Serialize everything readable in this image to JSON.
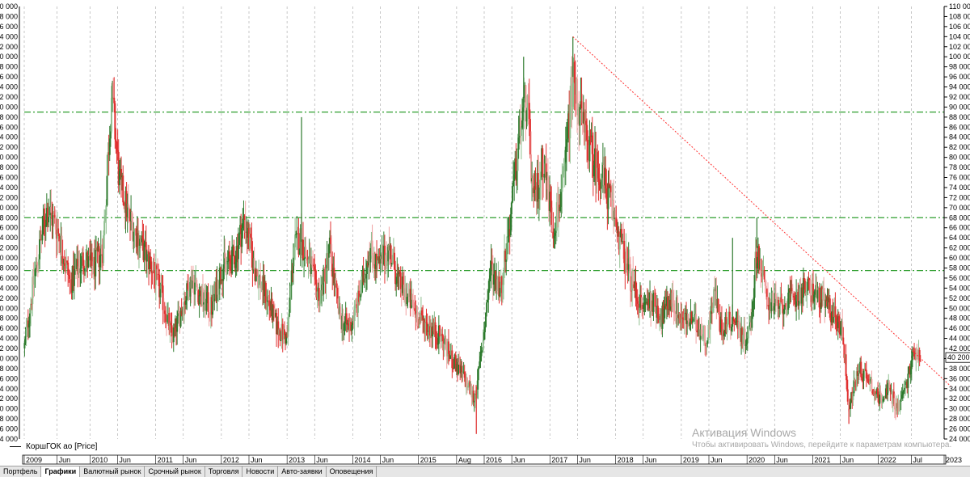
{
  "chart_data": {
    "type": "candlestick",
    "ylim": [
      24000,
      110000
    ],
    "y_ticks": [
      24000,
      26000,
      28000,
      30000,
      32000,
      34000,
      36000,
      38000,
      40000,
      42000,
      44000,
      46000,
      48000,
      50000,
      52000,
      54000,
      56000,
      58000,
      60000,
      62000,
      64000,
      66000,
      68000,
      70000,
      72000,
      74000,
      76000,
      78000,
      80000,
      82000,
      84000,
      86000,
      88000,
      90000,
      92000,
      94000,
      96000,
      98000,
      100000,
      102000,
      104000,
      106000,
      108000,
      110000
    ],
    "y_tick_labels": [
      "24 000",
      "26 000",
      "28 000",
      "30 000",
      "32 000",
      "34 000",
      "36 000",
      "38 000",
      "40 000",
      "42 000",
      "44 000",
      "46 000",
      "48 000",
      "50 000",
      "52 000",
      "54 000",
      "56 000",
      "58 000",
      "60 000",
      "62 000",
      "64 000",
      "66 000",
      "68 000",
      "70 000",
      "72 000",
      "74 000",
      "76 000",
      "78 000",
      "80 000",
      "82 000",
      "84 000",
      "86 000",
      "88 000",
      "90 000",
      "92 000",
      "94 000",
      "96 000",
      "98 000",
      "100 000",
      "102 000",
      "104 000",
      "106 000",
      "108 000",
      "110 000"
    ],
    "last_price_label": "40 200",
    "last_price": 40200,
    "time_labels": [
      {
        "t": 2009.0,
        "label": "2009"
      },
      {
        "t": 2009.5,
        "label": "Jun"
      },
      {
        "t": 2010.0,
        "label": "2010"
      },
      {
        "t": 2010.42,
        "label": "Jun"
      },
      {
        "t": 2011.0,
        "label": "2011"
      },
      {
        "t": 2011.42,
        "label": "Jun"
      },
      {
        "t": 2012.0,
        "label": "2012"
      },
      {
        "t": 2012.42,
        "label": "Jun"
      },
      {
        "t": 2013.0,
        "label": "2013"
      },
      {
        "t": 2013.42,
        "label": "Jun"
      },
      {
        "t": 2014.0,
        "label": "2014"
      },
      {
        "t": 2014.42,
        "label": "Jun"
      },
      {
        "t": 2015.0,
        "label": "2015"
      },
      {
        "t": 2015.58,
        "label": "Aug"
      },
      {
        "t": 2016.0,
        "label": "2016"
      },
      {
        "t": 2016.42,
        "label": "Jun"
      },
      {
        "t": 2017.0,
        "label": "2017"
      },
      {
        "t": 2017.42,
        "label": "Jun"
      },
      {
        "t": 2018.0,
        "label": "2018"
      },
      {
        "t": 2018.42,
        "label": "Jun"
      },
      {
        "t": 2019.0,
        "label": "2019"
      },
      {
        "t": 2019.42,
        "label": "Jun"
      },
      {
        "t": 2020.0,
        "label": "2020"
      },
      {
        "t": 2020.42,
        "label": "Jun"
      },
      {
        "t": 2021.0,
        "label": "2021"
      },
      {
        "t": 2021.42,
        "label": "Jun"
      },
      {
        "t": 2022.0,
        "label": "2022"
      },
      {
        "t": 2022.5,
        "label": "Jul"
      },
      {
        "t": 2023.0,
        "label": "2023"
      }
    ],
    "horizontal_levels": [
      89000,
      68000,
      57500
    ],
    "trend_line": {
      "t0": 2017.35,
      "y0": 104000,
      "t1": 2023.1,
      "y1": 34500
    },
    "series_name": "КоршГОК ао [Price]",
    "anchors": [
      [
        2009.0,
        42000
      ],
      [
        2009.15,
        56000
      ],
      [
        2009.35,
        70000
      ],
      [
        2009.5,
        66000
      ],
      [
        2009.7,
        55000
      ],
      [
        2009.9,
        60000
      ],
      [
        2010.05,
        58000
      ],
      [
        2010.2,
        62000
      ],
      [
        2010.33,
        93000
      ],
      [
        2010.45,
        75000
      ],
      [
        2010.6,
        68000
      ],
      [
        2010.8,
        62000
      ],
      [
        2010.95,
        58000
      ],
      [
        2011.1,
        52000
      ],
      [
        2011.25,
        44000
      ],
      [
        2011.4,
        50000
      ],
      [
        2011.55,
        56000
      ],
      [
        2011.7,
        52000
      ],
      [
        2011.85,
        50000
      ],
      [
        2012.0,
        58000
      ],
      [
        2012.2,
        60000
      ],
      [
        2012.35,
        68000
      ],
      [
        2012.5,
        58000
      ],
      [
        2012.7,
        52000
      ],
      [
        2012.85,
        46000
      ],
      [
        2013.0,
        44000
      ],
      [
        2013.1,
        62000
      ],
      [
        2013.2,
        64000
      ],
      [
        2013.35,
        58000
      ],
      [
        2013.5,
        52000
      ],
      [
        2013.65,
        62000
      ],
      [
        2013.8,
        48000
      ],
      [
        2013.95,
        46000
      ],
      [
        2014.1,
        52000
      ],
      [
        2014.25,
        62000
      ],
      [
        2014.4,
        58000
      ],
      [
        2014.55,
        62000
      ],
      [
        2014.7,
        55000
      ],
      [
        2014.85,
        52000
      ],
      [
        2015.0,
        48000
      ],
      [
        2015.2,
        46000
      ],
      [
        2015.35,
        44000
      ],
      [
        2015.5,
        40000
      ],
      [
        2015.7,
        36000
      ],
      [
        2015.85,
        32000
      ],
      [
        2015.95,
        40000
      ],
      [
        2016.1,
        58000
      ],
      [
        2016.25,
        54000
      ],
      [
        2016.4,
        68000
      ],
      [
        2016.55,
        86000
      ],
      [
        2016.65,
        92000
      ],
      [
        2016.75,
        70000
      ],
      [
        2016.9,
        80000
      ],
      [
        2017.05,
        66000
      ],
      [
        2017.2,
        74000
      ],
      [
        2017.35,
        96000
      ],
      [
        2017.5,
        86000
      ],
      [
        2017.65,
        80000
      ],
      [
        2017.8,
        76000
      ],
      [
        2017.95,
        70000
      ],
      [
        2018.1,
        62000
      ],
      [
        2018.25,
        55000
      ],
      [
        2018.4,
        50000
      ],
      [
        2018.55,
        52000
      ],
      [
        2018.7,
        48000
      ],
      [
        2018.85,
        52000
      ],
      [
        2019.0,
        48000
      ],
      [
        2019.2,
        47000
      ],
      [
        2019.4,
        44000
      ],
      [
        2019.5,
        54000
      ],
      [
        2019.6,
        46000
      ],
      [
        2019.8,
        48000
      ],
      [
        2019.95,
        44000
      ],
      [
        2020.05,
        46000
      ],
      [
        2020.15,
        62000
      ],
      [
        2020.3,
        52000
      ],
      [
        2020.5,
        50000
      ],
      [
        2020.7,
        52000
      ],
      [
        2020.9,
        54000
      ],
      [
        2021.05,
        53000
      ],
      [
        2021.25,
        50000
      ],
      [
        2021.45,
        46000
      ],
      [
        2021.55,
        30000
      ],
      [
        2021.7,
        38000
      ],
      [
        2021.85,
        36000
      ],
      [
        2022.0,
        32000
      ],
      [
        2022.15,
        34000
      ],
      [
        2022.3,
        30000
      ],
      [
        2022.45,
        36000
      ],
      [
        2022.55,
        42000
      ],
      [
        2022.65,
        40200
      ]
    ],
    "spikes": [
      [
        2010.33,
        93000
      ],
      [
        2013.22,
        88000
      ],
      [
        2016.6,
        100000
      ],
      [
        2017.35,
        104000
      ],
      [
        2019.78,
        64000
      ],
      [
        2020.15,
        68000
      ],
      [
        2021.55,
        27000
      ],
      [
        2015.88,
        25000
      ]
    ]
  },
  "tabs": [
    {
      "label": "Портфель",
      "active": false
    },
    {
      "label": "Графики",
      "active": true
    },
    {
      "label": "Валютный рынок",
      "active": false
    },
    {
      "label": "Срочный рынок",
      "active": false
    },
    {
      "label": "Торговля",
      "active": false
    },
    {
      "label": "Новости",
      "active": false
    },
    {
      "label": "Авто-заявки",
      "active": false
    },
    {
      "label": "Оповещения",
      "active": false
    }
  ],
  "legend": {
    "label": "КоршГОК ао [Price]"
  },
  "watermark": {
    "title": "Активация Windows",
    "subtitle": "Чтобы активировать Windows, перейдите к параметрам компьютера."
  },
  "colors": {
    "up": "#2d7a2d",
    "down": "#e03030",
    "up_light": "#8fbf8f",
    "down_light": "#f0a0a0",
    "level": "#2e9e2e",
    "trend": "#ff3333",
    "grid": "#b0b0b0"
  }
}
